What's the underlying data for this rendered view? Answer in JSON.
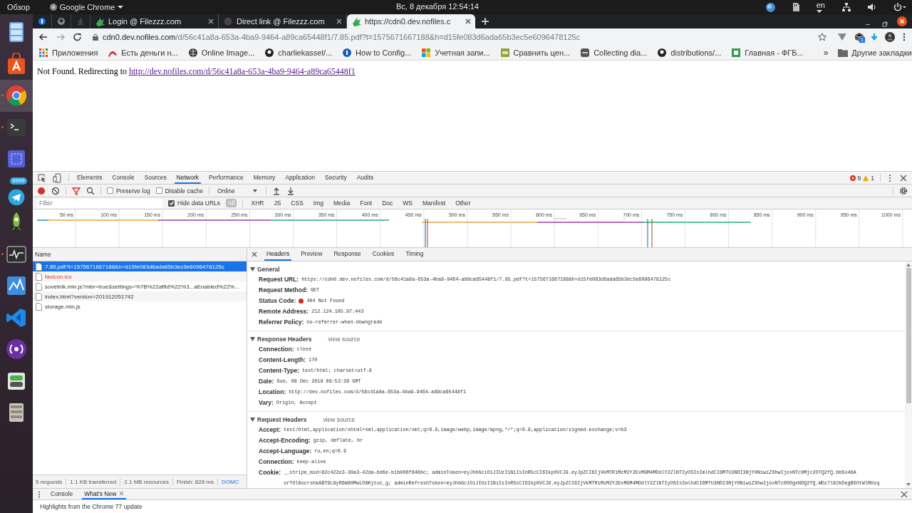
{
  "system_bar": {
    "activities": "Обзор",
    "app_menu": "Google Chrome",
    "clock": "Вс, 8 декабря 12:54:14",
    "language": "en"
  },
  "dock": {
    "badge": "9999"
  },
  "browser": {
    "tabs": [
      {
        "title": "Login @ Filezzz.com",
        "selected": false
      },
      {
        "title": "Direct link @ Filezzz.com",
        "selected": false
      },
      {
        "title": "https://cdn0.dev.nofiles.c",
        "selected": true
      }
    ],
    "address": {
      "host": "cdn0.dev.nofiles.com",
      "path": "/d/56c41a8a-653a-4ba9-9464-a89ca65448f1/7.85.pdf?t=1575671667188&h=d15fe083d6ada65b3ec5e6096478125c"
    },
    "extension_badge": "1",
    "bookmarks": [
      "Приложения",
      "Есть деньги н...",
      "Online Image...",
      "charliekassel/...",
      "How to Config...",
      "Учетная запи...",
      "Сравнить цен...",
      "Collecting dia...",
      "distributions/...",
      "Главная - ФГБ..."
    ],
    "more_bookmarks": "»",
    "other_bookmarks": "Другие закладки",
    "page": {
      "text": "Not Found. Redirecting to",
      "link": "http://dev.nofiles.com/d/56c41a8a-653a-4ba9-9464-a89ca65448f1"
    }
  },
  "devtools": {
    "tabs": [
      {
        "label": "Elements",
        "selected": false
      },
      {
        "label": "Console",
        "selected": false
      },
      {
        "label": "Sources",
        "selected": false
      },
      {
        "label": "Network",
        "selected": true
      },
      {
        "label": "Performance",
        "selected": false
      },
      {
        "label": "Memory",
        "selected": false
      },
      {
        "label": "Application",
        "selected": false
      },
      {
        "label": "Security",
        "selected": false
      },
      {
        "label": "Audits",
        "selected": false
      }
    ],
    "errors": "9",
    "warnings": "1",
    "toolbar": {
      "recording": true,
      "preserve_log": {
        "label": "Preserve log",
        "checked": false
      },
      "disable_cache": {
        "label": "Disable cache",
        "checked": false
      },
      "throttling": "Online"
    },
    "filter": {
      "placeholder": "Filter",
      "hide_data_urls": {
        "label": "Hide data URLs",
        "checked": true
      },
      "types": [
        {
          "label": "All",
          "selected": true
        },
        {
          "label": "XHR",
          "selected": false
        },
        {
          "label": "JS",
          "selected": false
        },
        {
          "label": "CSS",
          "selected": false
        },
        {
          "label": "Img",
          "selected": false
        },
        {
          "label": "Media",
          "selected": false
        },
        {
          "label": "Font",
          "selected": false
        },
        {
          "label": "Doc",
          "selected": false
        },
        {
          "label": "WS",
          "selected": false
        },
        {
          "label": "Manifest",
          "selected": false
        },
        {
          "label": "Other",
          "selected": false
        }
      ]
    },
    "overview": {
      "ticks": [
        "50 ms",
        "100 ms",
        "150 ms",
        "200 ms",
        "250 ms",
        "300 ms",
        "350 ms",
        "400 ms",
        "450 ms",
        "500 ms",
        "550 ms",
        "600 ms",
        "650 ms",
        "700 ms",
        "750 ms",
        "800 ms",
        "850 ms",
        "900 ms",
        "950 ms",
        "1000 ms"
      ]
    },
    "requests": {
      "column": "Name",
      "rows": [
        {
          "name": "7.85.pdf?t=1575671667188&h=d15fe083d6ada65b3ec5e6096478125c",
          "selected": true,
          "failed": false
        },
        {
          "name": "favicon.ico",
          "selected": false,
          "failed": true
        },
        {
          "name": "sovetnik.min.js?mbr=true&settings=%7B%22affId%22%3...aEnabled%22%...",
          "selected": false,
          "failed": false
        },
        {
          "name": "index.html?version=201912051742",
          "selected": false,
          "failed": false
        },
        {
          "name": "storage.min.js",
          "selected": false,
          "failed": false
        }
      ],
      "summary": [
        "5 requests",
        "1.1 KB transferred",
        "2.1 MB resources",
        "Finish: 828 ms",
        "DOMC"
      ]
    },
    "details": {
      "tabs": [
        {
          "label": "Headers",
          "selected": true
        },
        {
          "label": "Preview",
          "selected": false
        },
        {
          "label": "Response",
          "selected": false
        },
        {
          "label": "Cookies",
          "selected": false
        },
        {
          "label": "Timing",
          "selected": false
        }
      ],
      "sections": [
        {
          "title": "General",
          "expanded": true,
          "rows": [
            {
              "name": "Request URL:",
              "value": "https://cdn0.dev.nofiles.com/d/56c41a8a-653a-4ba9-9464-a89ca65448f1/7.85.pdf?t=1575671667188&h=d15fe083d6ada65b3ec5e6096478125c"
            },
            {
              "name": "Request Method:",
              "value": "GET"
            },
            {
              "name": "Status Code:",
              "value": "404 Not Found",
              "kind": "status"
            },
            {
              "name": "Remote Address:",
              "value": "212.124.105.97:443"
            },
            {
              "name": "Referrer Policy:",
              "value": "no-referrer-when-downgrade"
            }
          ]
        },
        {
          "title": "Response Headers",
          "expanded": true,
          "view_source": "view source",
          "rows": [
            {
              "name": "Connection:",
              "value": "close"
            },
            {
              "name": "Content-Length:",
              "value": "170"
            },
            {
              "name": "Content-Type:",
              "value": "text/html; charset=utf-8"
            },
            {
              "name": "Date:",
              "value": "Sun, 08 Dec 2019 09:53:39 GMT"
            },
            {
              "name": "Location:",
              "value": "http://dev.nofiles.com/d/56c41a8a-653a-4ba9-9464-a89ca65448f1"
            },
            {
              "name": "Vary:",
              "value": "Origin, Accept"
            }
          ]
        },
        {
          "title": "Request Headers",
          "expanded": true,
          "view_source": "view source",
          "rows": [
            {
              "name": "Accept:",
              "value": "text/html,application/xhtml+xml,application/xml;q=0.9,image/webp,image/apng,*/*;q=0.8,application/signed-exchange;v=b3"
            },
            {
              "name": "Accept-Encoding:",
              "value": "gzip, deflate, br"
            },
            {
              "name": "Accept-Language:",
              "value": "ru,en;q=0.9"
            },
            {
              "name": "Connection:",
              "value": "keep-alive"
            },
            {
              "name": "Cookie:",
              "value": "__stripe_mid=82c422e3-30a3-42da-bd6e-b1b006f646bc; adminToken=eyJhbGciOiJIUzI1NiIsInR5cCI6IkpXVCJ9.eyJpZCI6IjVkMTRiMzM2Y2ExMGM4MDdlY2ZlNTIyOSIsImlhdCI6MTU3NDI3NjY0NiwiZXhwIjoxNTc0Mjc2OTQ2fQ.bbSx4bA\norTOl6ocrshkABT9L8yR6W80MwLO8Kjtuc_g; adminRefreshToken=eyJhbGciOiJIUzI1NiIsInR5cCI6IkpXVCJ9.eyJpZCI6IjVkMTRiMzM2Y2ExMGM4MDdlY2ZlNTIyOSIsImlhdCI6MTU3NDI3NjY0NiwiZXhwIjoxNTc0ODgxNDQ2fQ.WDz7l82kDegBXOtWlRHzq"
            }
          ]
        }
      ]
    },
    "drawer": {
      "tabs": [
        {
          "label": "Console",
          "selected": false
        },
        {
          "label": "What's New",
          "selected": true
        }
      ],
      "text": "Highlights from the Chrome 77 update"
    }
  }
}
